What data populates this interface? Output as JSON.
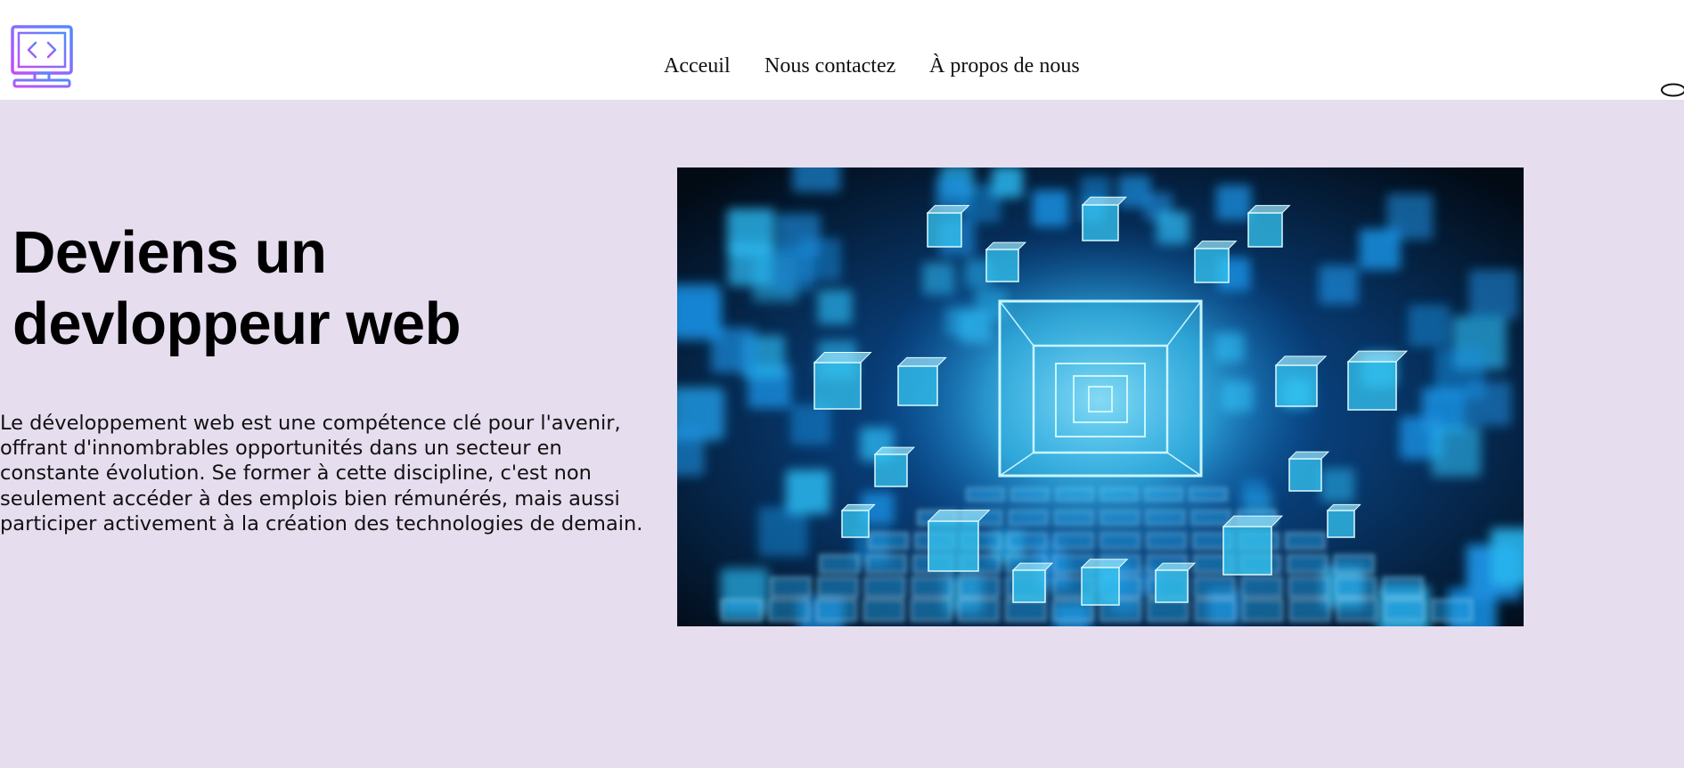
{
  "header": {
    "logo_icon": "monitor-code-icon",
    "nav": {
      "home": "Acceuil",
      "contact": "Nous contactez",
      "about": "À propos de nous"
    },
    "search_icon": "search-icon"
  },
  "hero": {
    "title": "Deviens un devloppeur web",
    "description": "Le développement web est une compétence clé pour l'avenir, offrant d'innombrables opportunités dans un secteur en constante évolution. Se former à cette discipline, c'est non seulement accéder à des emplois bien rémunérés, mais aussi participer activement à la création des technologies de demain.",
    "image": "glowing-blue-cubes-image"
  },
  "colors": {
    "page_background": "#e6ddef",
    "header_background": "#ffffff",
    "logo_gradient_start": "#c24dfb",
    "logo_gradient_end": "#4d8cff",
    "image_accent": "#29c6f5"
  }
}
